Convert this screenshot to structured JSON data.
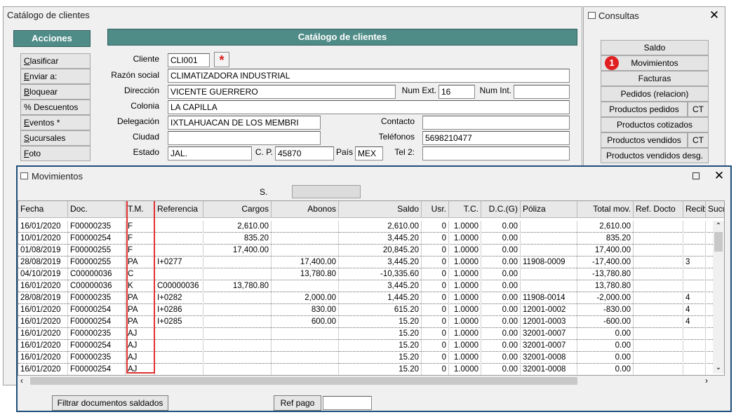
{
  "catalog": {
    "window_title": "Catálogo de clientes",
    "header": "Catálogo de clientes",
    "actions_label": "Acciones",
    "menu": [
      "Clasificar",
      "Enviar a:",
      "Bloquear",
      "% Descuentos",
      "Eventos *",
      "Sucursales",
      "Foto"
    ],
    "labels": {
      "cliente": "Cliente",
      "razon": "Razón social",
      "direccion": "Dirección",
      "num_ext": "Num Ext.",
      "num_int": "Num Int.",
      "colonia": "Colonia",
      "delegacion": "Delegación",
      "contacto": "Contacto",
      "ciudad": "Ciudad",
      "telefonos": "Teléfonos",
      "estado": "Estado",
      "cp": "C. P.",
      "pais": "País",
      "tel2": "Tel 2:"
    },
    "values": {
      "cliente": "CLI001",
      "razon": "CLIMATIZADORA INDUSTRIAL",
      "direccion": "VICENTE GUERRERO",
      "num_ext": "16",
      "num_int": "",
      "colonia": "LA CAPILLA",
      "delegacion": "IXTLAHUACAN DE LOS MEMBRI",
      "contacto": "",
      "ciudad": "",
      "telefonos": "5698210477",
      "estado": "JAL.",
      "cp": "45870",
      "pais": "MEX",
      "tel2": ""
    },
    "required_mark": "*"
  },
  "consultas": {
    "title": "Consultas",
    "badge": "1",
    "items": [
      {
        "label": "Saldo",
        "ct": ""
      },
      {
        "label": "Movimientos",
        "ct": ""
      },
      {
        "label": "Facturas",
        "ct": ""
      },
      {
        "label": "Pedidos (relacion)",
        "ct": ""
      },
      {
        "label": "Productos pedidos",
        "ct": "CT"
      },
      {
        "label": "Productos cotizados",
        "ct": ""
      },
      {
        "label": "Productos vendidos",
        "ct": "CT"
      },
      {
        "label": "Productos vendidos desg.",
        "ct": ""
      }
    ]
  },
  "movimientos": {
    "title": "Movimientos",
    "s_label": "S.",
    "columns": [
      "Fecha",
      "Doc.",
      "T.M.",
      "Referencia",
      "Cargos",
      "Abonos",
      "Saldo",
      "Usr.",
      "T.C.",
      "D.C.(G)",
      "Póliza",
      "Total mov.",
      "Ref. Docto",
      "Recib",
      "Sucu"
    ],
    "rows": [
      [
        "16/01/2020",
        "F00000235",
        "F",
        "",
        "2,610.00",
        "",
        "2,610.00",
        "0",
        "1.0000",
        "0.00",
        "",
        "2,610.00",
        "",
        "",
        ""
      ],
      [
        "10/01/2020",
        "F00000254",
        "F",
        "",
        "835.20",
        "",
        "3,445.20",
        "0",
        "1.0000",
        "0.00",
        "",
        "835.20",
        "",
        "",
        ""
      ],
      [
        "01/08/2019",
        "F00000255",
        "F",
        "",
        "17,400.00",
        "",
        "20,845.20",
        "0",
        "1.0000",
        "0.00",
        "",
        "17,400.00",
        "",
        "",
        ""
      ],
      [
        "28/08/2019",
        "F00000255",
        "PA",
        "I+0277",
        "",
        "17,400.00",
        "3,445.20",
        "0",
        "1.0000",
        "0.00",
        "11908-0009",
        "-17,400.00",
        "",
        "3",
        ""
      ],
      [
        "04/10/2019",
        "C00000036",
        "C",
        "",
        "",
        "13,780.80",
        "-10,335.60",
        "0",
        "1.0000",
        "0.00",
        "",
        "-13,780.80",
        "",
        "",
        ""
      ],
      [
        "16/01/2020",
        "C00000036",
        "K",
        "C00000036",
        "13,780.80",
        "",
        "3,445.20",
        "0",
        "1.0000",
        "0.00",
        "",
        "13,780.80",
        "",
        "",
        ""
      ],
      [
        "28/08/2019",
        "F00000235",
        "PA",
        "I+0282",
        "",
        "2,000.00",
        "1,445.20",
        "0",
        "1.0000",
        "0.00",
        "11908-0014",
        "-2,000.00",
        "",
        "4",
        ""
      ],
      [
        "16/01/2020",
        "F00000254",
        "PA",
        "I+0286",
        "",
        "830.00",
        "615.20",
        "0",
        "1.0000",
        "0.00",
        "12001-0002",
        "-830.00",
        "",
        "4",
        ""
      ],
      [
        "16/01/2020",
        "F00000254",
        "PA",
        "I+0285",
        "",
        "600.00",
        "15.20",
        "0",
        "1.0000",
        "0.00",
        "12001-0003",
        "-600.00",
        "",
        "4",
        ""
      ],
      [
        "16/01/2020",
        "F00000235",
        "AJ",
        "",
        "",
        "",
        "15.20",
        "0",
        "1.0000",
        "0.00",
        "32001-0007",
        "0.00",
        "",
        "",
        ""
      ],
      [
        "16/01/2020",
        "F00000254",
        "AJ",
        "",
        "",
        "",
        "15.20",
        "0",
        "1.0000",
        "0.00",
        "32001-0007",
        "0.00",
        "",
        "",
        ""
      ],
      [
        "16/01/2020",
        "F00000235",
        "AJ",
        "",
        "",
        "",
        "15.20",
        "0",
        "1.0000",
        "0.00",
        "32001-0008",
        "0.00",
        "",
        "",
        ""
      ],
      [
        "16/01/2020",
        "F00000254",
        "AJ",
        "",
        "",
        "",
        "15.20",
        "0",
        "1.0000",
        "0.00",
        "32001-0008",
        "0.00",
        "",
        "",
        ""
      ]
    ],
    "filter_button": "Filtrar  documentos saldados",
    "ref_pago_button": "Ref pago",
    "ref_pago_value": ""
  },
  "colors": {
    "header_teal": "#4f8c88",
    "badge_red": "#e02020",
    "highlight_red": "#e03030",
    "window_border": "#1f4e79"
  }
}
